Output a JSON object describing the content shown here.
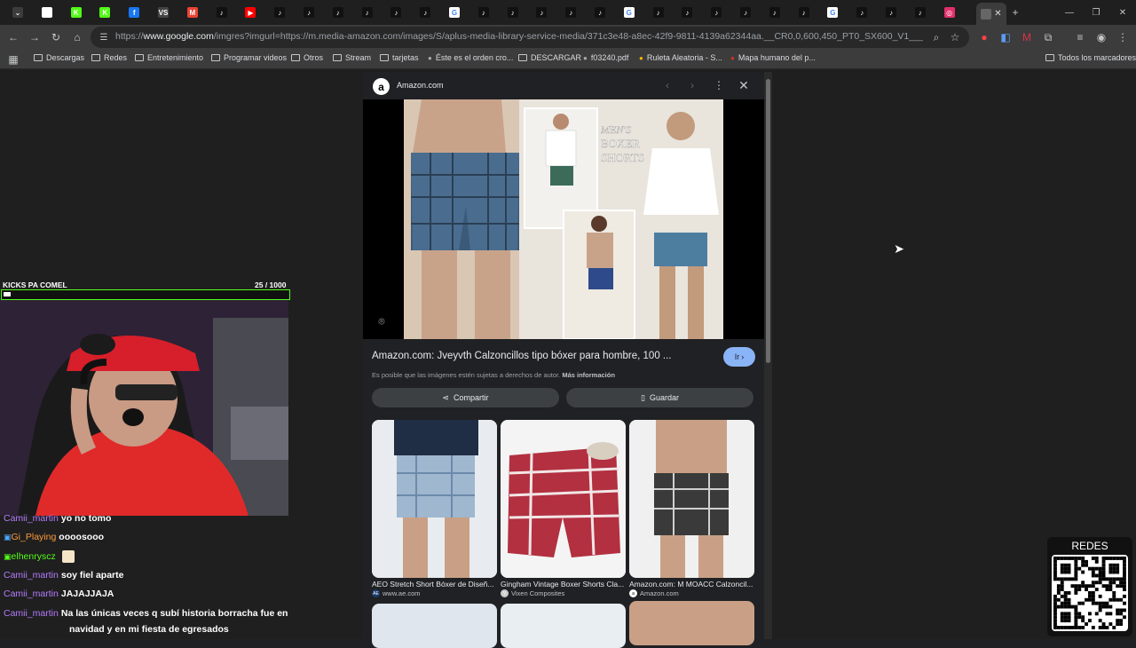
{
  "browser": {
    "tabs": [
      {
        "icon": "tab-menu-icon",
        "label": "⌄",
        "color": "#3c3c3c"
      },
      {
        "icon": "shield-icon",
        "label": "",
        "color": "#ffffff"
      },
      {
        "icon": "kick-icon",
        "label": "K",
        "color": "#53fc18"
      },
      {
        "icon": "kick-icon",
        "label": "K",
        "color": "#53fc18"
      },
      {
        "icon": "facebook-icon",
        "label": "f",
        "color": "#1877f2"
      },
      {
        "icon": "vs-icon",
        "label": "VS",
        "color": "#444444"
      },
      {
        "icon": "gmail-icon",
        "label": "M",
        "color": "#ea4335"
      },
      {
        "icon": "tiktok-icon",
        "label": "♪",
        "color": "#111111"
      },
      {
        "icon": "youtube-icon",
        "label": "▶",
        "color": "#ff0000"
      },
      {
        "icon": "tiktok-icon",
        "label": "♪",
        "color": "#111111"
      },
      {
        "icon": "tiktok-icon",
        "label": "♪",
        "color": "#111111"
      },
      {
        "icon": "tiktok-icon",
        "label": "♪",
        "color": "#111111"
      },
      {
        "icon": "tiktok-icon",
        "label": "♪",
        "color": "#111111"
      },
      {
        "icon": "tiktok-icon",
        "label": "♪",
        "color": "#111111"
      },
      {
        "icon": "tiktok-icon",
        "label": "♪",
        "color": "#111111"
      },
      {
        "icon": "google-icon",
        "label": "G",
        "color": "#ffffff"
      },
      {
        "icon": "tiktok-icon",
        "label": "♪",
        "color": "#111111"
      },
      {
        "icon": "tiktok-icon",
        "label": "♪",
        "color": "#111111"
      },
      {
        "icon": "tiktok-icon",
        "label": "♪",
        "color": "#111111"
      },
      {
        "icon": "tiktok-icon",
        "label": "♪",
        "color": "#111111"
      },
      {
        "icon": "tiktok-icon",
        "label": "♪",
        "color": "#111111"
      },
      {
        "icon": "google-icon",
        "label": "G",
        "color": "#ffffff"
      },
      {
        "icon": "tiktok-icon",
        "label": "♪",
        "color": "#111111"
      },
      {
        "icon": "tiktok-icon",
        "label": "♪",
        "color": "#111111"
      },
      {
        "icon": "tiktok-icon",
        "label": "♪",
        "color": "#111111"
      },
      {
        "icon": "tiktok-icon",
        "label": "♪",
        "color": "#111111"
      },
      {
        "icon": "tiktok-icon",
        "label": "♪",
        "color": "#111111"
      },
      {
        "icon": "tiktok-icon",
        "label": "♪",
        "color": "#111111"
      },
      {
        "icon": "google-icon",
        "label": "G",
        "color": "#ffffff"
      },
      {
        "icon": "tiktok-icon",
        "label": "♪",
        "color": "#111111"
      },
      {
        "icon": "tiktok-icon",
        "label": "♪",
        "color": "#111111"
      },
      {
        "icon": "tiktok-icon",
        "label": "♪",
        "color": "#111111"
      },
      {
        "icon": "instagram-icon",
        "label": "◎",
        "color": "#e1306c"
      }
    ],
    "url_prefix": "https://",
    "url_domain": "www.google.com",
    "url_rest": "/imgres?imgurl=https://m.media-amazon.com/images/S/aplus-media-library-service-media/371c3e48-a8ec-42f9-9811-4139a62344aa.__CR0,0,600,450_PT0_SX600_V1___.jpg&tbnid=rztP-5uXnKn...",
    "bookmarks": [
      {
        "label": "Descargas",
        "icon": "folder-icon"
      },
      {
        "label": "Redes",
        "icon": "folder-icon"
      },
      {
        "label": "Entretenimiento",
        "icon": "folder-icon"
      },
      {
        "label": "Programar videos",
        "icon": "folder-icon"
      },
      {
        "label": "Otros",
        "icon": "folder-icon"
      },
      {
        "label": "Stream",
        "icon": "folder-icon"
      },
      {
        "label": "tarjetas",
        "icon": "folder-icon"
      },
      {
        "label": "Éste es el orden cro...",
        "icon": "bottle-icon"
      },
      {
        "label": "DESCARGAR",
        "icon": "folder-icon"
      },
      {
        "label": "f03240.pdf",
        "icon": "globe-icon"
      },
      {
        "label": "Ruleta Aleatoria - S...",
        "icon": "roulette-icon"
      },
      {
        "label": "Mapa humano del p...",
        "icon": "map-icon"
      }
    ],
    "all_bookmarks": "Todos los marcadores"
  },
  "stream": {
    "kicks_title": "KICKS PA COMEL",
    "kicks_count": "25  / 1000",
    "kicks_progress": 0.025,
    "accent": "#53fc18",
    "chat": [
      {
        "user": "Camii_martin",
        "color": "#b57bff",
        "msg": "yo no tomo",
        "badge": ""
      },
      {
        "user": "Gi_Playing",
        "color": "#ff9a3c",
        "msg": "oooosooo",
        "badge": "badge-icon"
      },
      {
        "user": "elhenryscz",
        "color": "#53fc18",
        "msg": "",
        "badge": "badge-icon",
        "emote": true
      },
      {
        "user": "Camii_martin",
        "color": "#b57bff",
        "msg": "soy fiel aparte",
        "badge": ""
      },
      {
        "user": "Camii_martin",
        "color": "#b57bff",
        "msg": "JAJAJJAJA",
        "badge": ""
      },
      {
        "user": "Camii_martin",
        "color": "#b57bff",
        "msg": "Na las únicas veces q subí historia borracha fue en",
        "badge": ""
      }
    ],
    "chat_continuation": "navidad y en mi fiesta de egresados",
    "redes_label": "REDES"
  },
  "panel": {
    "source_name": "Amazon.com",
    "source_logo": "a",
    "preview_text_1": "MEN'S",
    "preview_text_2": "BOXER",
    "preview_text_3": "SHORTS",
    "result_title": "Amazon.com: Jveyvth Calzoncillos tipo bóxer para hombre, 100 ...",
    "visit_label": "Ir",
    "copyright_text": "Es posible que las imágenes estén sujetas a derechos de autor.",
    "more_info": "Más información",
    "share_label": "Compartir",
    "save_label": "Guardar",
    "related": [
      {
        "title": "AEO Stretch Short Bóxer de Diseñ...",
        "source": "www.ae.com",
        "favicon": "AE",
        "fav_color": "#1b3a6b"
      },
      {
        "title": "Gingham Vintage Boxer Shorts Cla...",
        "source": "Vixen Composites",
        "favicon": "V",
        "fav_color": "#cccccc"
      },
      {
        "title": "Amazon.com: M MOACC Calzoncil...",
        "source": "Amazon.com",
        "favicon": "a",
        "fav_color": "#ffffff"
      }
    ]
  }
}
